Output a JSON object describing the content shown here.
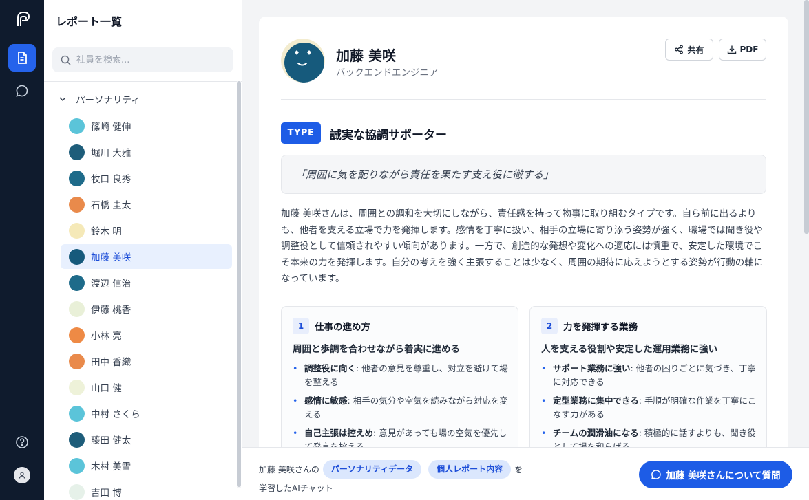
{
  "sidebar": {
    "title": "レポート一覧",
    "search_placeholder": "社員を検索...",
    "group": {
      "label": "パーソナリティ",
      "expanded": true
    },
    "members": [
      {
        "name": "篠崎 健伸",
        "color": "#5bc4d9"
      },
      {
        "name": "堀川 大雅",
        "color": "#1e5d7a"
      },
      {
        "name": "牧口 良秀",
        "color": "#1e6b8a"
      },
      {
        "name": "石橋 圭太",
        "color": "#e98a4b"
      },
      {
        "name": "鈴木 明",
        "color": "#f5e9b8"
      },
      {
        "name": "加藤 美咲",
        "color": "#165a7c",
        "active": true
      },
      {
        "name": "渡辺 信治",
        "color": "#1e6b8a"
      },
      {
        "name": "伊藤 桃香",
        "color": "#e9f0d8"
      },
      {
        "name": "小林 亮",
        "color": "#ee8a45"
      },
      {
        "name": "田中 香織",
        "color": "#e98a4b"
      },
      {
        "name": "山口 健",
        "color": "#eef2d9"
      },
      {
        "name": "中村 さくら",
        "color": "#5bc4d9"
      },
      {
        "name": "藤田 健太",
        "color": "#1e5d7a"
      },
      {
        "name": "木村 美雪",
        "color": "#5bc4d9"
      },
      {
        "name": "吉田 博",
        "color": "#e6f1e9"
      }
    ]
  },
  "profile": {
    "name": "加藤 美咲",
    "role": "バックエンドエンジニア",
    "share_label": "共有",
    "pdf_label": "PDF",
    "type_badge": "TYPE",
    "type_title": "誠実な協調サポーター",
    "quote": "「周囲に気を配りながら責任を果たす支え役に徹する」",
    "summary": "加藤 美咲さんは、周囲との調和を大切にしながら、責任感を持って物事に取り組むタイプです。自ら前に出るよりも、他者を支える立場で力を発揮します。感情を丁寧に扱い、相手の立場に寄り添う姿勢が強く、職場では聞き役や調整役として信頼されやすい傾向があります。一方で、創造的な発想や変化への適応には慎重で、安定した環境でこそ本来の力を発揮します。自分の考えを強く主張することは少なく、周囲の期待に応えようとする姿勢が行動の軸になっています。",
    "sections": [
      {
        "num": "1",
        "title": "仕事の進め方",
        "subtitle": "周囲と歩調を合わせながら着実に進める",
        "items": [
          {
            "head": "調整役に向く",
            "text": ": 他者の意見を尊重し、対立を避けて場を整える"
          },
          {
            "head": "感情に敏感",
            "text": ": 相手の気分や空気を読みながら対応を変える"
          },
          {
            "head": "自己主張は控えめ",
            "text": ": 意見があっても場の空気を優先して発言を控える"
          }
        ]
      },
      {
        "num": "2",
        "title": "力を発揮する業務",
        "subtitle": "人を支える役割や安定した運用業務に強い",
        "items": [
          {
            "head": "サポート業務に強い",
            "text": ": 他者の困りごとに気づき、丁寧に対応できる"
          },
          {
            "head": "定型業務に集中できる",
            "text": ": 手順が明確な作業を丁寧にこなす力がある"
          },
          {
            "head": "チームの潤滑油になる",
            "text": ": 積極的に話すよりも、聞き役として場を和らげる"
          }
        ]
      }
    ]
  },
  "chatbar": {
    "prefix": "加藤 美咲さんの",
    "chip1": "パーソナリティデータ",
    "chip2": "個人レポート内容",
    "suffix": "を",
    "line2": "学習したAIチャット",
    "button_label": "加藤 美咲さんについて質問"
  },
  "colors": {
    "accent": "#1d5ce6",
    "rail": "#0f1b2d",
    "avatar_main": "#165a7c"
  }
}
